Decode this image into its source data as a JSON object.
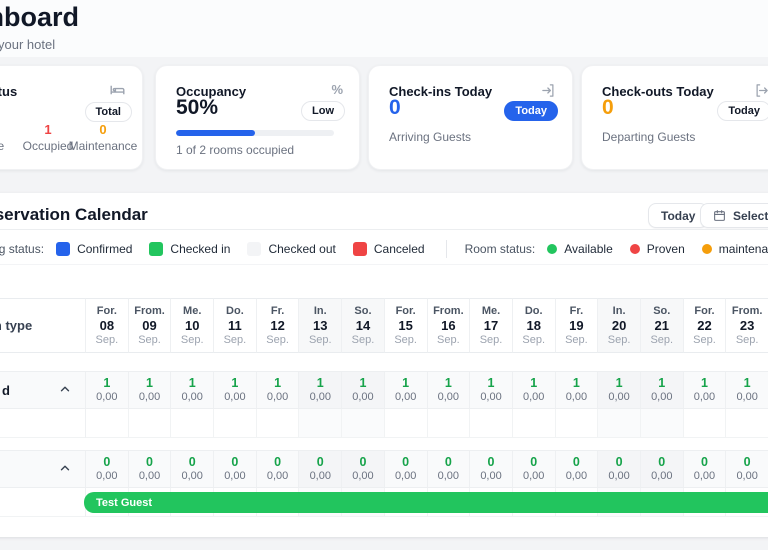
{
  "page": {
    "title": "Dashboard",
    "subtitle": "your hotel"
  },
  "colors": {
    "blue": "#2563eb",
    "green": "#16a34a",
    "bar_green": "#22c55e",
    "red": "#ef4444",
    "orange": "#f59e0b"
  },
  "cards": {
    "room_status": {
      "title": "Room Status",
      "icon": "bed-icon",
      "badge": "Total",
      "stats": [
        {
          "label": "Available",
          "value": "",
          "color": "#16a34a"
        },
        {
          "label": "Occupied",
          "value": "1",
          "color": "#ef4444"
        },
        {
          "label": "Maintenance",
          "value": "0",
          "color": "#f59e0b"
        }
      ]
    },
    "occupancy": {
      "title": "Occupancy",
      "icon": "percent-icon",
      "value": "50%",
      "badge": "Low",
      "progress_pct": 50,
      "progress_color": "#2563eb",
      "caption": "1 of 2 rooms occupied"
    },
    "checkins": {
      "title": "Check-ins Today",
      "icon": "login-icon",
      "value": "0",
      "value_color": "#2563eb",
      "badge": "Today",
      "caption": "Arriving Guests"
    },
    "checkouts": {
      "title": "Check-outs Today",
      "icon": "logout-icon",
      "value": "0",
      "value_color": "#f59e0b",
      "badge": "Today",
      "caption": "Departing Guests"
    }
  },
  "calendar": {
    "title": "Reservation Calendar",
    "today_button": "Today",
    "select_date_button": "Select date",
    "legend": {
      "booking_label": "Booking status:",
      "booking_items": [
        {
          "label": "Confirmed",
          "color": "#2563eb"
        },
        {
          "label": "Checked in",
          "color": "#22c55e"
        },
        {
          "label": "Checked out",
          "color": "#f3f4f6"
        },
        {
          "label": "Canceled",
          "color": "#ef4444"
        }
      ],
      "room_label": "Room status:",
      "room_items": [
        {
          "label": "Available",
          "color": "#22c55e"
        },
        {
          "label": "Proven",
          "color": "#ef4444"
        },
        {
          "label": "maintenance",
          "color": "#f59e0b"
        }
      ]
    },
    "table": {
      "corner_label": "Room type",
      "month": "Sep.",
      "days": [
        {
          "dow": "For.",
          "day": "08",
          "weekend": false
        },
        {
          "dow": "From.",
          "day": "09",
          "weekend": false
        },
        {
          "dow": "Me.",
          "day": "10",
          "weekend": false
        },
        {
          "dow": "Do.",
          "day": "11",
          "weekend": false
        },
        {
          "dow": "Fr.",
          "day": "12",
          "weekend": false
        },
        {
          "dow": "In.",
          "day": "13",
          "weekend": true
        },
        {
          "dow": "So.",
          "day": "14",
          "weekend": true
        },
        {
          "dow": "For.",
          "day": "15",
          "weekend": false
        },
        {
          "dow": "From.",
          "day": "16",
          "weekend": false
        },
        {
          "dow": "Me.",
          "day": "17",
          "weekend": false
        },
        {
          "dow": "Do.",
          "day": "18",
          "weekend": false
        },
        {
          "dow": "Fr.",
          "day": "19",
          "weekend": false
        },
        {
          "dow": "In.",
          "day": "20",
          "weekend": true
        },
        {
          "dow": "So.",
          "day": "21",
          "weekend": true
        },
        {
          "dow": "For.",
          "day": "22",
          "weekend": false
        },
        {
          "dow": "From.",
          "day": "23",
          "weekend": false
        }
      ],
      "groups": [
        {
          "label_fragment": "d",
          "count": "1",
          "price": "0,00",
          "booking": null
        },
        {
          "label_fragment": "",
          "count": "0",
          "price": "0,00",
          "booking": {
            "guest": "Test Guest",
            "color": "#22c55e",
            "start_day": "08"
          }
        }
      ]
    }
  }
}
